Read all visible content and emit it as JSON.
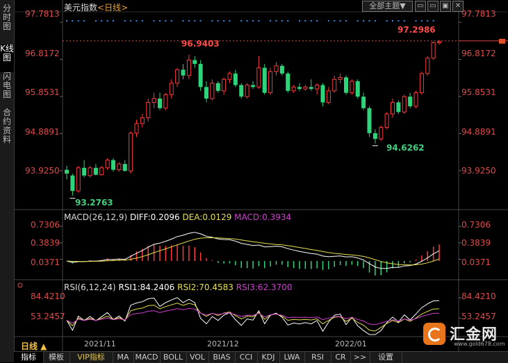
{
  "window": {
    "title": "美元指数",
    "timeframe": "<日线>",
    "theme_button": "全部主题▼"
  },
  "sidebar": {
    "tabs": [
      "分时图",
      "K线图",
      "闪电图",
      "合约资料"
    ],
    "active": 1
  },
  "price_panel": {
    "axis_labels": [
      "97.7813",
      "96.8172",
      "95.8531",
      "94.8891",
      "93.9250"
    ],
    "axis_values": [
      97.7813,
      96.8172,
      95.8531,
      94.8891,
      93.925
    ],
    "range": [
      92.95,
      98.0
    ],
    "annotations": {
      "high": "96.9403",
      "low_start": "93.2763",
      "low": "94.6262",
      "last": "97.2986"
    },
    "last_value": 97.2986
  },
  "macd_panel": {
    "header": {
      "name": "MACD(26,12,9)",
      "diff": "DIFF:0.2096",
      "dea": "DEA:0.0129",
      "macd": "MACD:0.3934"
    },
    "axis_labels": [
      "0.7306",
      "0.3839",
      "0.0371"
    ],
    "axis_values": [
      0.7306,
      0.3839,
      0.0371
    ],
    "range": [
      -0.35,
      0.85
    ]
  },
  "rsi_panel": {
    "header": {
      "name": "RSI(6,12,24)",
      "rsi1": "RSI1:84.2406",
      "rsi2": "RSI2:70.4583",
      "rsi3": "RSI3:62.3700"
    },
    "axis_labels": [
      "84.4210",
      "53.2457"
    ],
    "axis_values": [
      84.421,
      53.2457
    ],
    "range": [
      28,
      92
    ]
  },
  "period_label": "日线 ▲",
  "date_labels": [
    "2021/11",
    "2021/12",
    "2022/01"
  ],
  "footer_tabs": [
    "指标",
    "模板",
    "VIP指标",
    "MA",
    "MACD",
    "BOLL",
    "VOL",
    "BIAS",
    "CCI",
    "KDJ",
    "LWA",
    "RSI",
    "CR",
    ">>",
    "设置"
  ],
  "footer_active": 0,
  "logo": {
    "name": "汇金网",
    "url": "www.gold678.com"
  },
  "colors": {
    "up": "#ff3b3b",
    "down": "#2ed47a",
    "axis": "#e04a4a",
    "diff": "#ffffff",
    "dea": "#e8e050",
    "rsi3": "#d040d0"
  },
  "chart_data": {
    "type": "candlestick",
    "series": [
      {
        "o": 93.95,
        "h": 94.05,
        "l": 93.7,
        "c": 93.85
      },
      {
        "o": 93.8,
        "h": 93.85,
        "l": 93.28,
        "c": 93.4
      },
      {
        "o": 93.4,
        "h": 94.05,
        "l": 93.35,
        "c": 94.0
      },
      {
        "o": 94.0,
        "h": 94.2,
        "l": 93.75,
        "c": 93.8
      },
      {
        "o": 93.8,
        "h": 94.05,
        "l": 93.75,
        "c": 94.0
      },
      {
        "o": 94.0,
        "h": 94.1,
        "l": 93.8,
        "c": 93.82
      },
      {
        "o": 93.82,
        "h": 94.05,
        "l": 93.8,
        "c": 94.0
      },
      {
        "o": 94.0,
        "h": 94.25,
        "l": 93.95,
        "c": 94.2
      },
      {
        "o": 94.2,
        "h": 94.25,
        "l": 93.9,
        "c": 93.95
      },
      {
        "o": 93.95,
        "h": 94.15,
        "l": 93.9,
        "c": 94.1
      },
      {
        "o": 94.1,
        "h": 94.2,
        "l": 93.9,
        "c": 93.92
      },
      {
        "o": 93.92,
        "h": 94.95,
        "l": 93.85,
        "c": 94.9
      },
      {
        "o": 94.9,
        "h": 95.25,
        "l": 94.8,
        "c": 95.15
      },
      {
        "o": 95.15,
        "h": 95.4,
        "l": 95.05,
        "c": 95.3
      },
      {
        "o": 95.3,
        "h": 95.8,
        "l": 95.2,
        "c": 95.7
      },
      {
        "o": 95.7,
        "h": 95.95,
        "l": 95.55,
        "c": 95.8
      },
      {
        "o": 95.8,
        "h": 95.95,
        "l": 95.5,
        "c": 95.55
      },
      {
        "o": 95.55,
        "h": 95.95,
        "l": 95.5,
        "c": 95.9
      },
      {
        "o": 95.9,
        "h": 96.3,
        "l": 95.8,
        "c": 96.2
      },
      {
        "o": 96.2,
        "h": 96.6,
        "l": 96.1,
        "c": 96.55
      },
      {
        "o": 96.55,
        "h": 96.7,
        "l": 96.3,
        "c": 96.4
      },
      {
        "o": 96.4,
        "h": 96.94,
        "l": 96.3,
        "c": 96.8
      },
      {
        "o": 96.8,
        "h": 96.9,
        "l": 96.6,
        "c": 96.7
      },
      {
        "o": 96.7,
        "h": 96.8,
        "l": 96.0,
        "c": 96.1
      },
      {
        "o": 96.1,
        "h": 96.25,
        "l": 95.7,
        "c": 95.8
      },
      {
        "o": 95.8,
        "h": 96.3,
        "l": 95.75,
        "c": 96.2
      },
      {
        "o": 96.2,
        "h": 96.25,
        "l": 95.95,
        "c": 96.0
      },
      {
        "o": 96.0,
        "h": 96.35,
        "l": 95.9,
        "c": 96.3
      },
      {
        "o": 96.3,
        "h": 96.5,
        "l": 96.2,
        "c": 96.45
      },
      {
        "o": 96.45,
        "h": 96.55,
        "l": 96.1,
        "c": 96.15
      },
      {
        "o": 96.15,
        "h": 96.2,
        "l": 95.8,
        "c": 95.85
      },
      {
        "o": 95.85,
        "h": 96.2,
        "l": 95.8,
        "c": 96.15
      },
      {
        "o": 96.15,
        "h": 96.25,
        "l": 96.05,
        "c": 96.1
      },
      {
        "o": 96.1,
        "h": 96.9,
        "l": 96.05,
        "c": 96.6
      },
      {
        "o": 96.6,
        "h": 96.7,
        "l": 95.9,
        "c": 95.95
      },
      {
        "o": 95.95,
        "h": 96.6,
        "l": 95.9,
        "c": 96.5
      },
      {
        "o": 96.5,
        "h": 96.75,
        "l": 96.4,
        "c": 96.65
      },
      {
        "o": 96.65,
        "h": 96.7,
        "l": 96.4,
        "c": 96.45
      },
      {
        "o": 96.45,
        "h": 96.5,
        "l": 95.95,
        "c": 96.0
      },
      {
        "o": 96.0,
        "h": 96.15,
        "l": 95.95,
        "c": 96.1
      },
      {
        "o": 96.1,
        "h": 96.2,
        "l": 96.0,
        "c": 96.05
      },
      {
        "o": 96.05,
        "h": 96.15,
        "l": 96.0,
        "c": 96.1
      },
      {
        "o": 96.1,
        "h": 96.3,
        "l": 96.0,
        "c": 96.05
      },
      {
        "o": 96.05,
        "h": 96.2,
        "l": 95.9,
        "c": 96.15
      },
      {
        "o": 96.15,
        "h": 96.2,
        "l": 95.6,
        "c": 95.7
      },
      {
        "o": 95.7,
        "h": 96.1,
        "l": 95.65,
        "c": 96.0
      },
      {
        "o": 96.0,
        "h": 96.4,
        "l": 95.95,
        "c": 96.3
      },
      {
        "o": 96.3,
        "h": 96.45,
        "l": 96.2,
        "c": 96.35
      },
      {
        "o": 96.35,
        "h": 96.4,
        "l": 95.9,
        "c": 95.95
      },
      {
        "o": 95.95,
        "h": 96.3,
        "l": 95.9,
        "c": 96.25
      },
      {
        "o": 96.25,
        "h": 96.3,
        "l": 95.8,
        "c": 95.85
      },
      {
        "o": 95.85,
        "h": 95.95,
        "l": 95.5,
        "c": 95.55
      },
      {
        "o": 95.55,
        "h": 95.6,
        "l": 94.8,
        "c": 94.9
      },
      {
        "o": 94.9,
        "h": 95.0,
        "l": 94.63,
        "c": 94.75
      },
      {
        "o": 94.75,
        "h": 95.1,
        "l": 94.7,
        "c": 95.05
      },
      {
        "o": 95.05,
        "h": 95.45,
        "l": 95.0,
        "c": 95.4
      },
      {
        "o": 95.4,
        "h": 95.8,
        "l": 95.3,
        "c": 95.7
      },
      {
        "o": 95.7,
        "h": 95.75,
        "l": 95.4,
        "c": 95.45
      },
      {
        "o": 95.45,
        "h": 95.9,
        "l": 95.4,
        "c": 95.85
      },
      {
        "o": 95.85,
        "h": 95.95,
        "l": 95.55,
        "c": 95.6
      },
      {
        "o": 95.6,
        "h": 96.0,
        "l": 95.55,
        "c": 95.95
      },
      {
        "o": 95.95,
        "h": 96.5,
        "l": 95.9,
        "c": 96.45
      },
      {
        "o": 96.45,
        "h": 96.9,
        "l": 96.4,
        "c": 96.85
      },
      {
        "o": 96.85,
        "h": 97.3,
        "l": 96.8,
        "c": 97.25
      },
      {
        "o": 97.25,
        "h": 97.32,
        "l": 97.2,
        "c": 97.28
      }
    ]
  }
}
